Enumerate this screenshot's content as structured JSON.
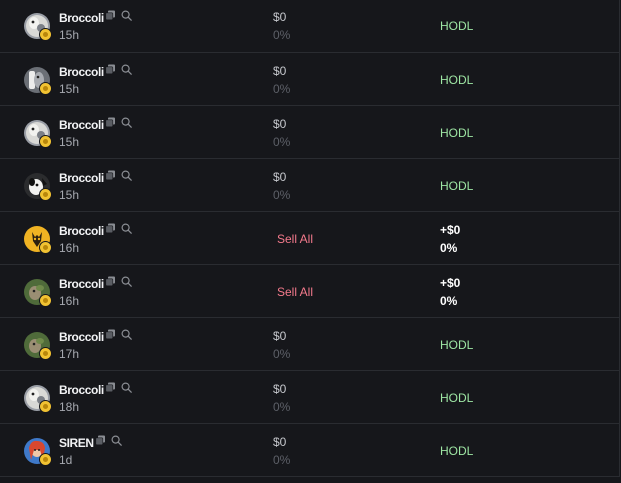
{
  "colors": {
    "background": "#16171b",
    "divider": "#2a2c31",
    "hodl_green": "#9ee6a4",
    "sell_red": "#f47a8c",
    "muted": "#5d6068",
    "badge_gold": "#f1c232"
  },
  "icons": {
    "copy": "copy-icon",
    "search": "search-icon",
    "badge": "verified-badge-icon"
  },
  "rows": [
    {
      "name": "Broccoli",
      "age": "15h",
      "avatar": "dog-avatar-white",
      "type": "hodl",
      "value": "$0",
      "pct": "0%",
      "action": "HODL"
    },
    {
      "name": "Broccoli",
      "age": "15h",
      "avatar": "dog-avatar-gray",
      "type": "hodl",
      "value": "$0",
      "pct": "0%",
      "action": "HODL"
    },
    {
      "name": "Broccoli",
      "age": "15h",
      "avatar": "dog-avatar-white",
      "type": "hodl",
      "value": "$0",
      "pct": "0%",
      "action": "HODL"
    },
    {
      "name": "Broccoli",
      "age": "15h",
      "avatar": "dog-avatar-bw",
      "type": "hodl",
      "value": "$0",
      "pct": "0%",
      "action": "HODL"
    },
    {
      "name": "Broccoli",
      "age": "16h",
      "avatar": "dog-avatar-yellow",
      "type": "sell",
      "sell_label": "Sell All",
      "pnl": "+$0",
      "pnl_pct": "0%"
    },
    {
      "name": "Broccoli",
      "age": "16h",
      "avatar": "dog-avatar-green",
      "type": "sell",
      "sell_label": "Sell All",
      "pnl": "+$0",
      "pnl_pct": "0%"
    },
    {
      "name": "Broccoli",
      "age": "17h",
      "avatar": "dog-avatar-green",
      "type": "hodl",
      "value": "$0",
      "pct": "0%",
      "action": "HODL"
    },
    {
      "name": "Broccoli",
      "age": "18h",
      "avatar": "dog-avatar-white",
      "type": "hodl",
      "value": "$0",
      "pct": "0%",
      "action": "HODL"
    },
    {
      "name": "SIREN",
      "age": "1d",
      "avatar": "siren-avatar",
      "type": "hodl",
      "value": "$0",
      "pct": "0%",
      "action": "HODL"
    }
  ]
}
